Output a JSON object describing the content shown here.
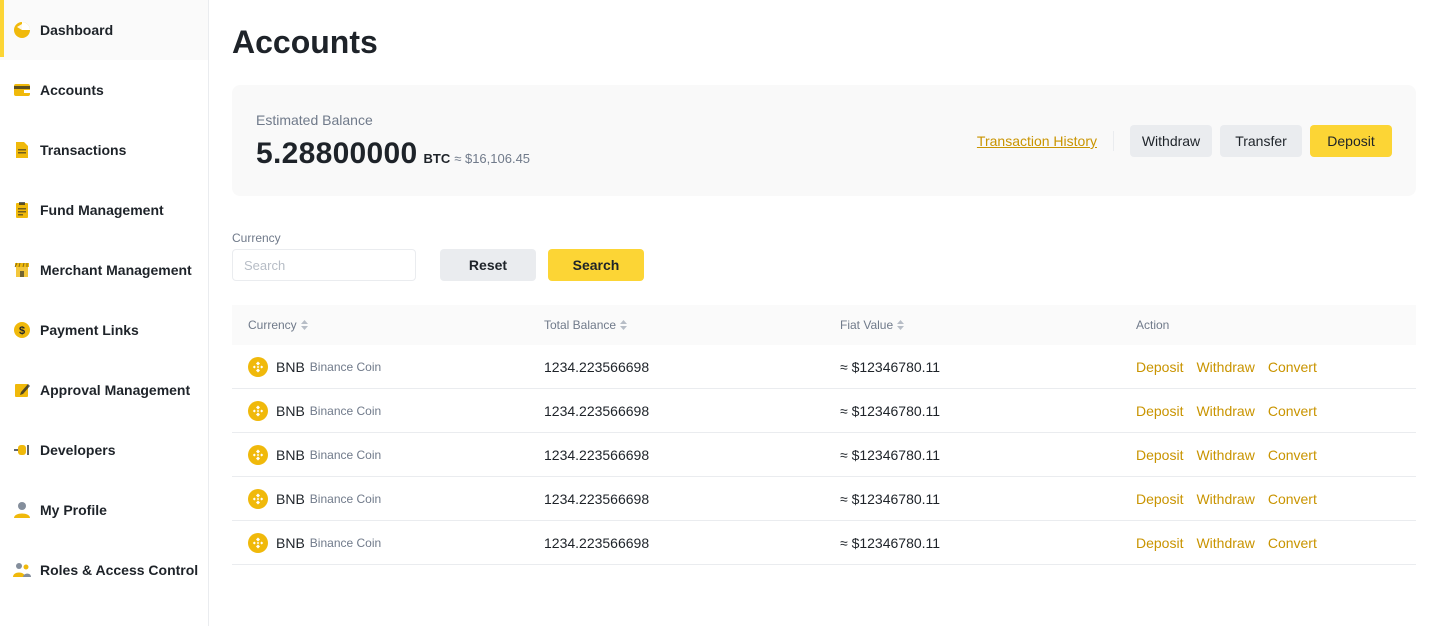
{
  "sidebar": {
    "items": [
      {
        "label": "Dashboard",
        "icon": "dashboard-icon",
        "active": true
      },
      {
        "label": "Accounts",
        "icon": "wallet-icon"
      },
      {
        "label": "Transactions",
        "icon": "document-icon"
      },
      {
        "label": "Fund Management",
        "icon": "clipboard-icon"
      },
      {
        "label": "Merchant Management",
        "icon": "store-icon"
      },
      {
        "label": "Payment Links",
        "icon": "coin-icon"
      },
      {
        "label": "Approval Management",
        "icon": "edit-icon"
      },
      {
        "label": "Developers",
        "icon": "plug-icon"
      },
      {
        "label": "My Profile",
        "icon": "user-icon"
      },
      {
        "label": "Roles & Access Control",
        "icon": "users-icon"
      }
    ]
  },
  "page": {
    "title": "Accounts"
  },
  "balance": {
    "label": "Estimated Balance",
    "value": "5.28800000",
    "unit": "BTC",
    "fiat": "≈ $16,106.45",
    "history_link": "Transaction History",
    "withdraw": "Withdraw",
    "transfer": "Transfer",
    "deposit": "Deposit"
  },
  "filter": {
    "label": "Currency",
    "placeholder": "Search",
    "reset": "Reset",
    "search": "Search"
  },
  "table": {
    "headers": [
      "Currency",
      "Total Balance",
      "Fiat Value",
      "Action"
    ],
    "rows": [
      {
        "symbol": "BNB",
        "name": "Binance Coin",
        "balance": "1234.223566698",
        "fiat": "≈ $12346780.11"
      },
      {
        "symbol": "BNB",
        "name": "Binance Coin",
        "balance": "1234.223566698",
        "fiat": "≈ $12346780.11"
      },
      {
        "symbol": "BNB",
        "name": "Binance Coin",
        "balance": "1234.223566698",
        "fiat": "≈ $12346780.11"
      },
      {
        "symbol": "BNB",
        "name": "Binance Coin",
        "balance": "1234.223566698",
        "fiat": "≈ $12346780.11"
      },
      {
        "symbol": "BNB",
        "name": "Binance Coin",
        "balance": "1234.223566698",
        "fiat": "≈ $12346780.11"
      }
    ],
    "actions": {
      "deposit": "Deposit",
      "withdraw": "Withdraw",
      "convert": "Convert"
    }
  },
  "colors": {
    "accent": "#fcd535",
    "link": "#c99400",
    "coin": "#f0b90b",
    "text": "#1e2329",
    "muted": "#707a8a"
  }
}
